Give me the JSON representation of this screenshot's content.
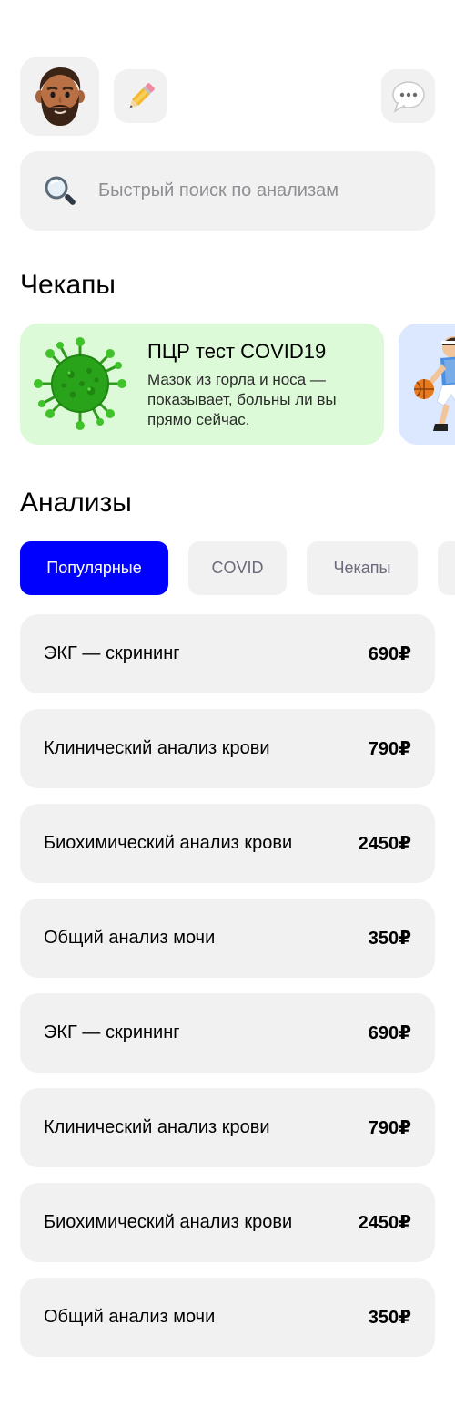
{
  "header": {
    "avatar_icon": "man-beard-emoji-icon",
    "edit_icon": "pencil-icon",
    "chat_icon": "speech-bubble-icon"
  },
  "search": {
    "placeholder": "Быстрый поиск по анализам",
    "icon": "search-icon"
  },
  "checkups": {
    "title": "Чекапы",
    "cards": [
      {
        "title": "ПЦР тест COVID19",
        "description": "Мазок из горла и носа — показывает, больны ли вы прямо сейчас.",
        "icon": "virus-icon",
        "color": "#dcfad7"
      },
      {
        "icon": "basketball-player-icon",
        "color": "#dce8ff"
      }
    ]
  },
  "tests": {
    "title": "Анализы",
    "filters": [
      {
        "label": "Популярные",
        "active": true
      },
      {
        "label": "COVID",
        "active": false
      },
      {
        "label": "Чекапы",
        "active": false
      }
    ],
    "items": [
      {
        "name": "ЭКГ — скрининг",
        "price": "690₽"
      },
      {
        "name": "Клинический анализ крови",
        "price": "790₽"
      },
      {
        "name": "Биохимический анализ крови",
        "price": "2450₽"
      },
      {
        "name": "Общий анализ мочи",
        "price": "350₽"
      },
      {
        "name": "ЭКГ — скрининг",
        "price": "690₽"
      },
      {
        "name": "Клинический анализ крови",
        "price": "790₽"
      },
      {
        "name": "Биохимический анализ крови",
        "price": "2450₽"
      },
      {
        "name": "Общий анализ мочи",
        "price": "350₽"
      }
    ]
  },
  "colors": {
    "accent": "#0000ff",
    "card_bg": "#f1f1f1",
    "chip_text": "#6b6b7b",
    "placeholder": "#8e8e93"
  }
}
